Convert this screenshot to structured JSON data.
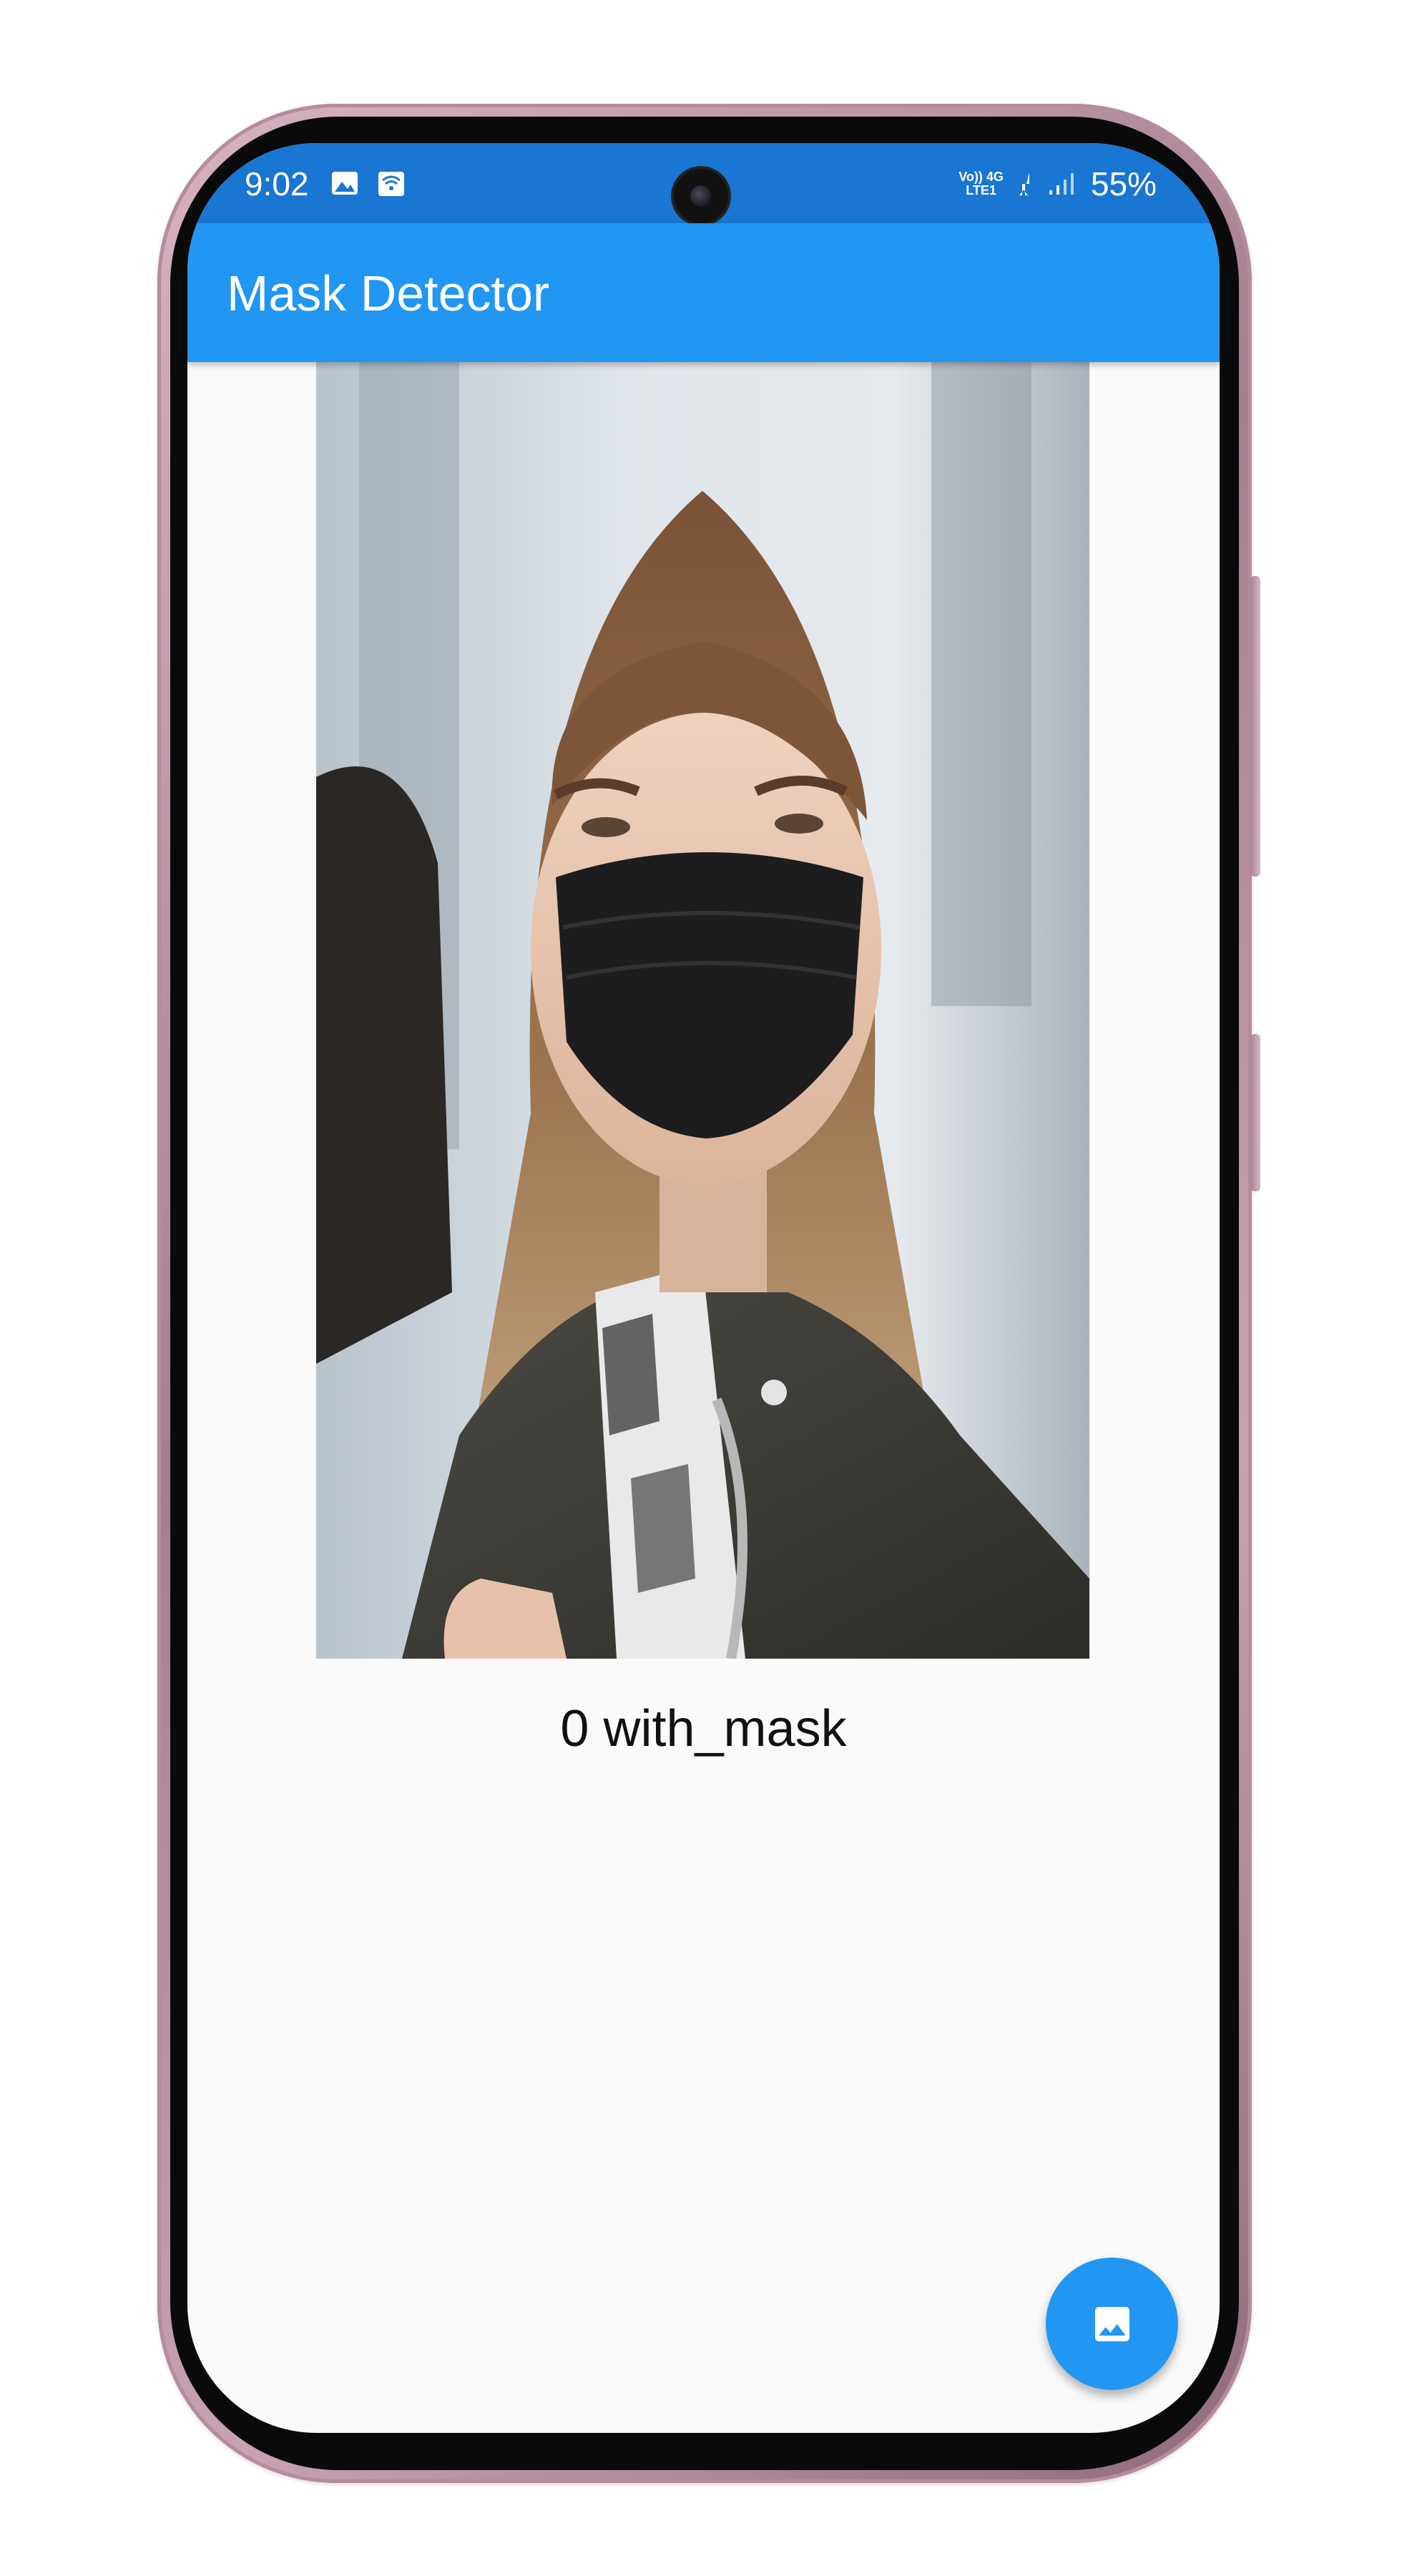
{
  "status_bar": {
    "time": "9:02",
    "network_top": "Vo)) 4G",
    "network_bottom": "LTE1",
    "battery": "55%",
    "icons": [
      "gallery-icon",
      "wifi-calling-icon",
      "volte-icon",
      "4g-data-icon",
      "signal-icon"
    ]
  },
  "app_bar": {
    "title": "Mask Detector"
  },
  "main": {
    "image_subject": "woman wearing black face mask",
    "result": "0 with_mask"
  },
  "fab": {
    "icon": "image-icon"
  },
  "colors": {
    "status_bar": "#1976d2",
    "app_bar": "#2196f3",
    "fab": "#2196f3",
    "background": "#fafafa"
  }
}
